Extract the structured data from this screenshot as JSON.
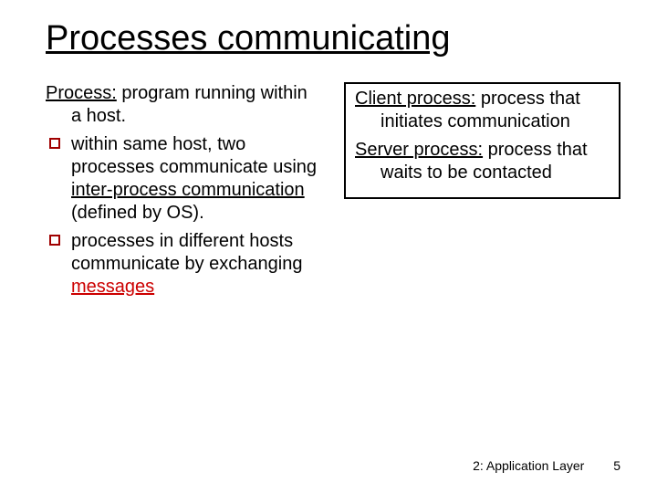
{
  "title": "Processes communicating",
  "left": {
    "process_label": "Process:",
    "process_def": " program running within a host.",
    "b1_pre": "within same host, two processes communicate using  ",
    "b1_uline": "inter-process communication",
    "b1_post": " (defined by OS).",
    "b2_pre": "processes in different hosts communicate by exchanging ",
    "b2_uline": "messages"
  },
  "right": {
    "client_label": "Client process:",
    "client_def": " process that initiates communication",
    "server_label": "Server process:",
    "server_def": " process that waits to be contacted"
  },
  "footer": {
    "section": "2: Application Layer",
    "page": "5"
  }
}
